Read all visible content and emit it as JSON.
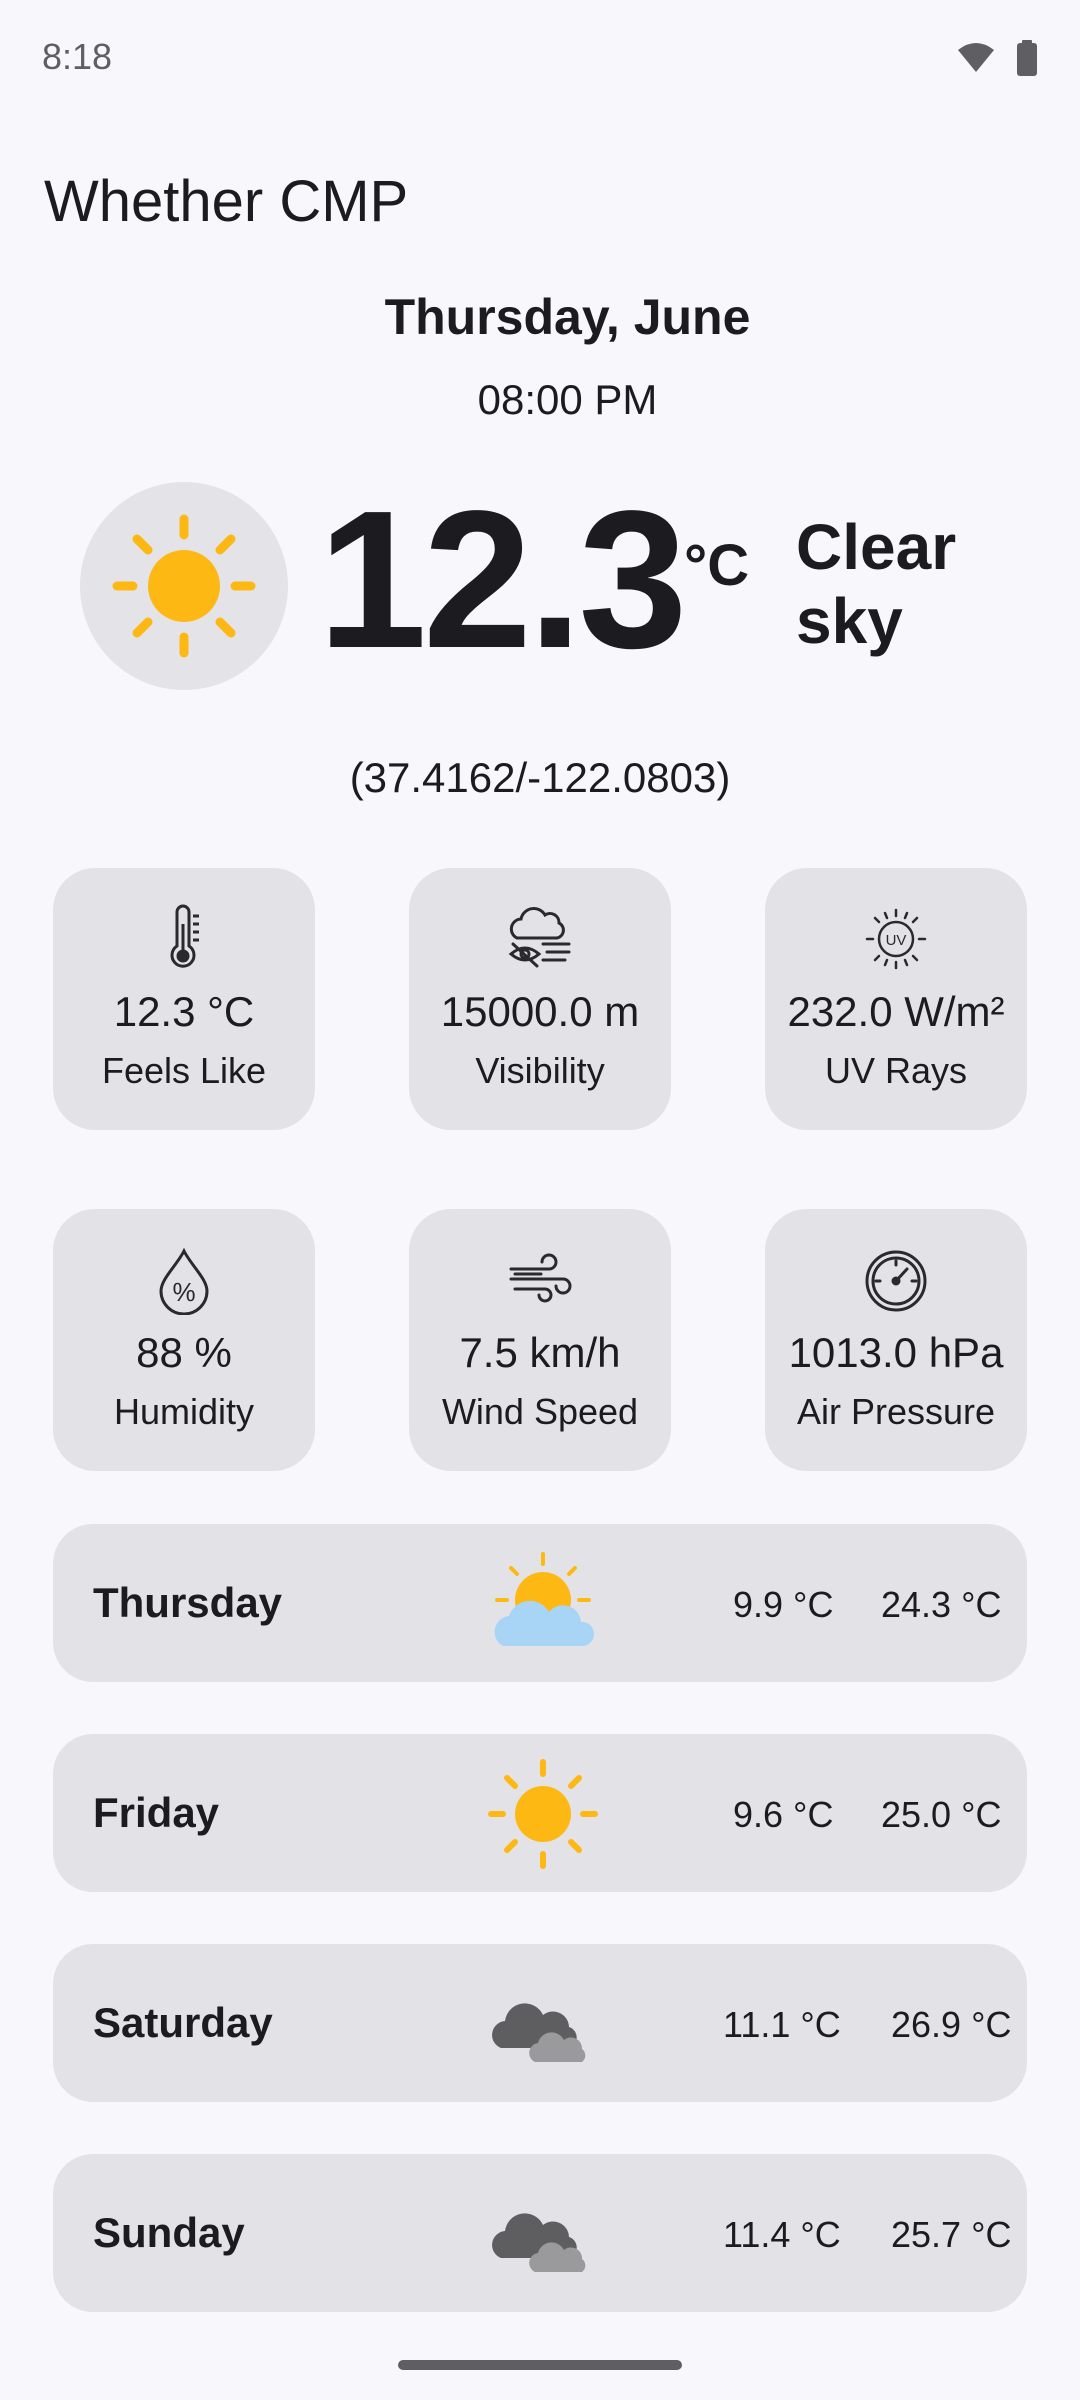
{
  "status_bar": {
    "time": "8:18",
    "icons": [
      "wifi-icon",
      "battery-icon"
    ]
  },
  "app": {
    "title": "Whether CMP"
  },
  "current": {
    "date": "Thursday, June",
    "time": "08:00 PM",
    "temperature": "12.3",
    "unit": "°C",
    "condition": "Clear sky",
    "coordinates": "(37.4162/-122.0803)",
    "icon": "sun-icon"
  },
  "metrics": [
    {
      "icon": "thermometer-icon",
      "value": "12.3 °C",
      "label": "Feels Like"
    },
    {
      "icon": "visibility-icon",
      "value": "15000.0 m",
      "label": "Visibility"
    },
    {
      "icon": "uv-icon",
      "value": "232.0 W/m²",
      "label": "UV Rays"
    },
    {
      "icon": "humidity-icon",
      "value": "88 %",
      "label": "Humidity"
    },
    {
      "icon": "wind-icon",
      "value": "7.5 km/h",
      "label": "Wind Speed"
    },
    {
      "icon": "pressure-gauge-icon",
      "value": "1013.0 hPa",
      "label": "Air Pressure"
    }
  ],
  "forecast": [
    {
      "day": "Thursday",
      "icon": "partly-cloudy-icon",
      "min": "9.9 °C",
      "max": "24.3 °C"
    },
    {
      "day": "Friday",
      "icon": "sun-icon",
      "min": "9.6 °C",
      "max": "25.0 °C"
    },
    {
      "day": "Saturday",
      "icon": "cloudy-icon",
      "min": "11.1 °C",
      "max": "26.9 °C"
    },
    {
      "day": "Sunday",
      "icon": "cloudy-icon",
      "min": "11.4 °C",
      "max": "25.7 °C"
    }
  ],
  "colors": {
    "background": "#F8F7FC",
    "card": "#E3E3E7",
    "sun": "#FDB813",
    "cloud_light": "#A8D4F5",
    "cloud_dark": "#6B6B6B"
  }
}
